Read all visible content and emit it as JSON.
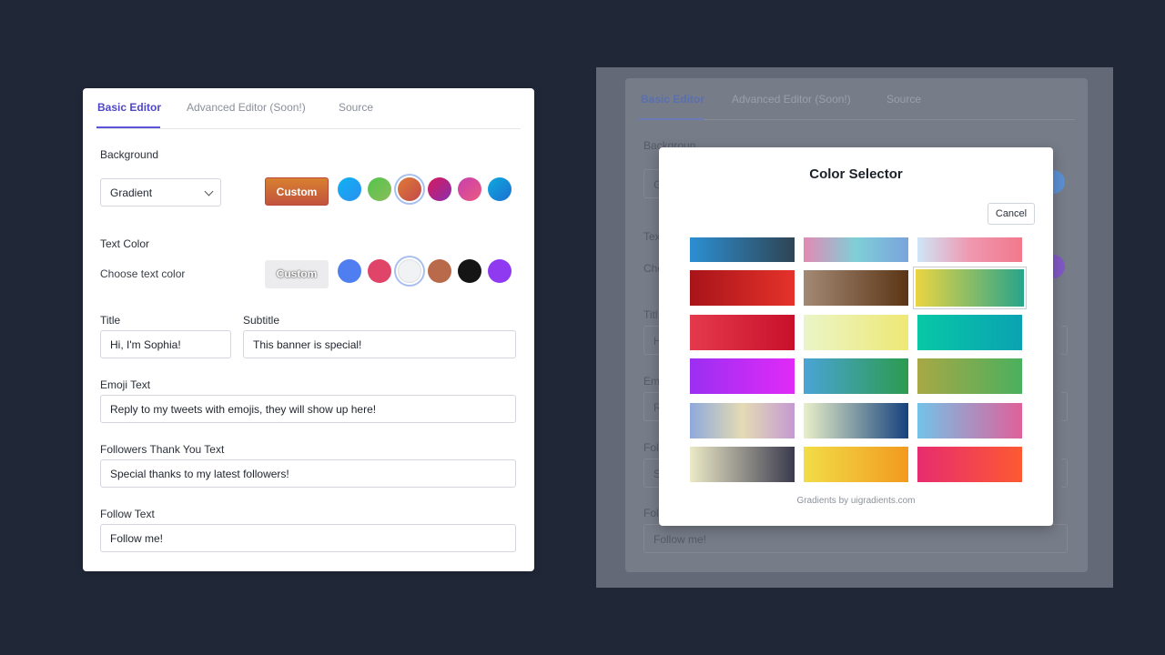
{
  "editor": {
    "tabs": [
      "Basic Editor",
      "Advanced Editor (Soon!)",
      "Source"
    ],
    "background": {
      "label": "Background",
      "select_value": "Gradient",
      "custom_label": "Custom",
      "swatches": [
        {
          "name": "cyan",
          "colors": [
            "#0fb3f3",
            "#2a8ff0"
          ]
        },
        {
          "name": "green",
          "colors": [
            "#53c44c",
            "#8bbd5a"
          ]
        },
        {
          "name": "orange-red",
          "colors": [
            "#e07a36",
            "#c24a4a"
          ]
        },
        {
          "name": "crimson",
          "colors": [
            "#d7195c",
            "#8a2fae"
          ]
        },
        {
          "name": "magenta",
          "colors": [
            "#c73fb0",
            "#ea5a7e"
          ]
        },
        {
          "name": "blue",
          "colors": [
            "#0fa9df",
            "#1c6fd0"
          ]
        }
      ],
      "selected_swatch": 2
    },
    "text_color": {
      "label": "Text Color",
      "hint": "Choose text color",
      "custom_label": "Custom",
      "swatches": [
        "#4e7ef0",
        "#e04468",
        "#f1f2f4",
        "#b96a4a",
        "#151515",
        "#8f3af0"
      ],
      "selected_swatch": 2
    },
    "title": {
      "label": "Title",
      "value": "Hi, I'm Sophia!"
    },
    "subtitle": {
      "label": "Subtitle",
      "value": "This banner is special!"
    },
    "emoji": {
      "label": "Emoji Text",
      "value": "Reply to my tweets with emojis, they will show up here!"
    },
    "followers": {
      "label": "Followers Thank You Text",
      "value": "Special thanks to my latest followers!"
    },
    "follow": {
      "label": "Follow Text",
      "value": "Follow me!"
    }
  },
  "ghost_panel": {
    "tabs": [
      "Basic Editor",
      "Advanced Editor (Soon!)",
      "Source"
    ],
    "background_label": "Backgroun",
    "select_fragment": "G",
    "text_color_fragment": "Tex",
    "hint_fragment": "Cho",
    "title_fragment": "Titl",
    "title_value_fragment": "H",
    "emoji_fragment": "Em",
    "emoji_value_fragment": "R",
    "followers_fragment": "Fol",
    "followers_value_fragment": "S",
    "follow_fragment": "Fol",
    "follow_value": "Follow me!"
  },
  "modal": {
    "title": "Color Selector",
    "cancel_label": "Cancel",
    "gradients": [
      [
        "#2c8fd2",
        "#2f4453"
      ],
      [
        "#e38ab4",
        "#7fcfd8",
        "#7aa3dc"
      ],
      [
        "#cfe6f8",
        "#ef98b0",
        "#f2788b"
      ],
      [
        "#a81419",
        "#e5322b"
      ],
      [
        "#a38975",
        "#5b3515"
      ],
      [
        "#ebd542",
        "#27a48b"
      ],
      [
        "#e43a4c",
        "#c8102b"
      ],
      [
        "#eaf5c8",
        "#eee874"
      ],
      [
        "#08c8a6",
        "#0aa2b2"
      ],
      [
        "#9b2ff2",
        "#e12af7"
      ],
      [
        "#4aa4d5",
        "#2b9b4f"
      ],
      [
        "#a8a845",
        "#4ab05e"
      ],
      [
        "#8ea9dc",
        "#e4dbb4",
        "#c49ad1"
      ],
      [
        "#e9efc9",
        "#15427d"
      ],
      [
        "#73c3e8",
        "#e0609a"
      ],
      [
        "#ece9c6",
        "#3a3a4e"
      ],
      [
        "#f2dd48",
        "#f29a1e"
      ],
      [
        "#e72c6f",
        "#fc5a32"
      ]
    ],
    "selected_gradient": 5,
    "credit": "Gradients by uigradients.com"
  }
}
